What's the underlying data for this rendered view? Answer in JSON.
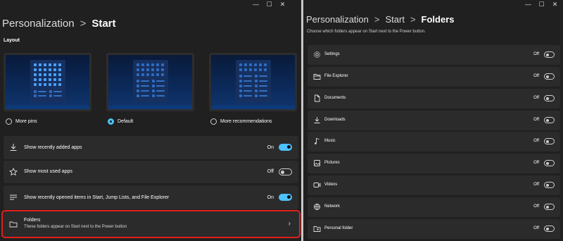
{
  "left": {
    "breadcrumb": {
      "parent": "Personalization",
      "separator": ">",
      "current": "Start"
    },
    "section_label": "Layout",
    "layout_options": [
      {
        "label": "More pins",
        "selected": false
      },
      {
        "label": "Default",
        "selected": true
      },
      {
        "label": "More recommendations",
        "selected": false
      }
    ],
    "settings": [
      {
        "icon": "download-icon",
        "label": "Show recently added apps",
        "state": "On",
        "on": true
      },
      {
        "icon": "star-icon",
        "label": "Show most used apps",
        "state": "Off",
        "on": false
      },
      {
        "icon": "list-icon",
        "label": "Show recently opened items in Start, Jump Lists, and File Explorer",
        "state": "On",
        "on": true
      }
    ],
    "folders": {
      "icon": "folder-icon",
      "label": "Folders",
      "description": "These folders appear on Start next to the Power button",
      "highlight_color": "#e0201c"
    }
  },
  "right": {
    "breadcrumb": {
      "parent": "Personalization",
      "middle": "Start",
      "separator": ">",
      "current": "Folders"
    },
    "description": "Choose which folders appear on Start next to the Power button.",
    "folders": [
      {
        "icon": "gear-icon",
        "label": "Settings",
        "state": "Off"
      },
      {
        "icon": "file-explorer-icon",
        "label": "File Explorer",
        "state": "Off"
      },
      {
        "icon": "document-icon",
        "label": "Documents",
        "state": "Off"
      },
      {
        "icon": "download-icon",
        "label": "Downloads",
        "state": "Off"
      },
      {
        "icon": "music-icon",
        "label": "Music",
        "state": "Off"
      },
      {
        "icon": "pictures-icon",
        "label": "Pictures",
        "state": "Off"
      },
      {
        "icon": "video-icon",
        "label": "Videos",
        "state": "Off"
      },
      {
        "icon": "network-icon",
        "label": "Network",
        "state": "Off"
      },
      {
        "icon": "personal-folder-icon",
        "label": "Personal folder",
        "state": "Off"
      }
    ]
  },
  "window_controls": {
    "minimize": "—",
    "maximize": "☐",
    "close": "✕"
  },
  "colors": {
    "background": "#202020",
    "card": "#2b2b2b",
    "accent": "#4cc2ff",
    "highlight": "#e0201c"
  }
}
